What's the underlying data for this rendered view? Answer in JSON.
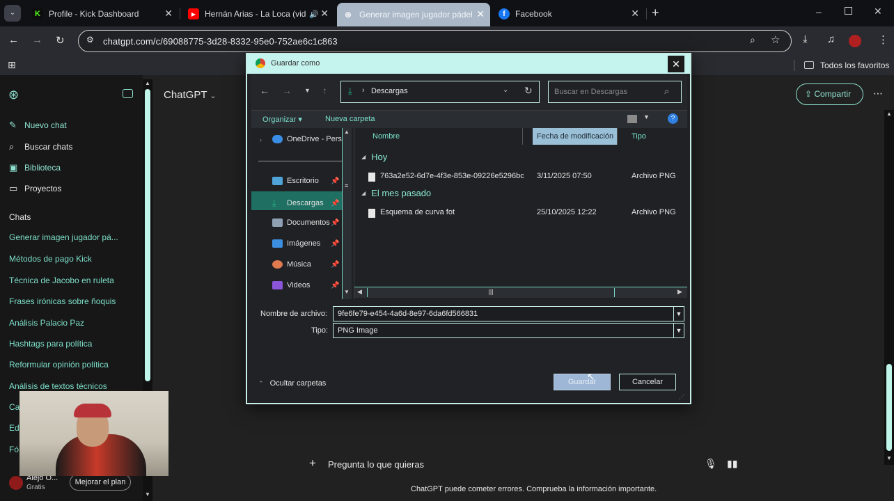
{
  "browser": {
    "tabs": [
      {
        "label": "Profile - Kick Dashboard",
        "icon": "kick-icon"
      },
      {
        "label": "Hernán Arias - La Loca (vide",
        "icon": "youtube-icon"
      },
      {
        "label": "Generar imagen jugador pádel",
        "icon": "chatgpt-icon"
      },
      {
        "label": "Facebook",
        "icon": "facebook-icon"
      }
    ],
    "url": "chatgpt.com/c/69088775-3d28-8332-95e0-752ae6c1c863",
    "bookmarks_all": "Todos los favoritos"
  },
  "chatgpt": {
    "model": "ChatGPT",
    "share": "Compartir",
    "nav": {
      "new_chat": "Nuevo chat",
      "search": "Buscar chats",
      "library": "Biblioteca",
      "projects": "Proyectos"
    },
    "chats_header": "Chats",
    "chats": [
      "Generar imagen jugador pá...",
      "Métodos de pago Kick",
      "Técnica de Jacobo en ruleta",
      "Frases irónicas sobre ñoquis",
      "Análisis Palacio Paz",
      "Hashtags para política",
      "Reformular opinión política",
      "Análisis de textos técnicos"
    ],
    "partial_chats": [
      "Ca",
      "Ed",
      "Fó"
    ],
    "user": {
      "name": "Alejo O...",
      "plan": "Gratis"
    },
    "upgrade": "Mejorar el plan",
    "composer_placeholder": "Pregunta lo que quieras",
    "disclaimer": "ChatGPT puede cometer errores. Comprueba la información importante."
  },
  "dialog": {
    "title": "Guardar como",
    "path": "Descargas",
    "search_placeholder": "Buscar en Descargas",
    "organize": "Organizar ▾",
    "new_folder": "Nueva carpeta",
    "nav_items": [
      {
        "label": "OneDrive - Pers",
        "color": "#3a8ee6"
      },
      {
        "label": "Escritorio",
        "color": "#4fa3d9"
      },
      {
        "label": "Descargas",
        "color": "#27c08a"
      },
      {
        "label": "Documentos",
        "color": "#8fa0b3"
      },
      {
        "label": "Imágenes",
        "color": "#3c8fe0"
      },
      {
        "label": "Música",
        "color": "#e07a4f"
      },
      {
        "label": "Videos",
        "color": "#8a55d8"
      }
    ],
    "columns": {
      "name": "Nombre",
      "date": "Fecha de modificación",
      "type": "Tipo"
    },
    "groups": [
      {
        "label": "Hoy",
        "files": [
          {
            "name": "763a2e52-6d7e-4f3e-853e-09226e5296bc",
            "date": "3/11/2025 07:50",
            "type": "Archivo PNG"
          }
        ]
      },
      {
        "label": "El mes pasado",
        "files": [
          {
            "name": "Esquema de curva fot",
            "date": "25/10/2025 12:22",
            "type": "Archivo PNG"
          }
        ]
      }
    ],
    "filename_label": "Nombre de archivo:",
    "filename_value": "9fe6fe79-e454-4a6d-8e97-6da6fd566831",
    "type_label": "Tipo:",
    "type_value": "PNG Image",
    "hide_folders": "Ocultar carpetas",
    "save": "Guardar",
    "cancel": "Cancelar"
  },
  "colors": {
    "accent": "#8fe3d0",
    "dialog_border": "#c6eee6",
    "save_button": "#9fb7d6"
  }
}
